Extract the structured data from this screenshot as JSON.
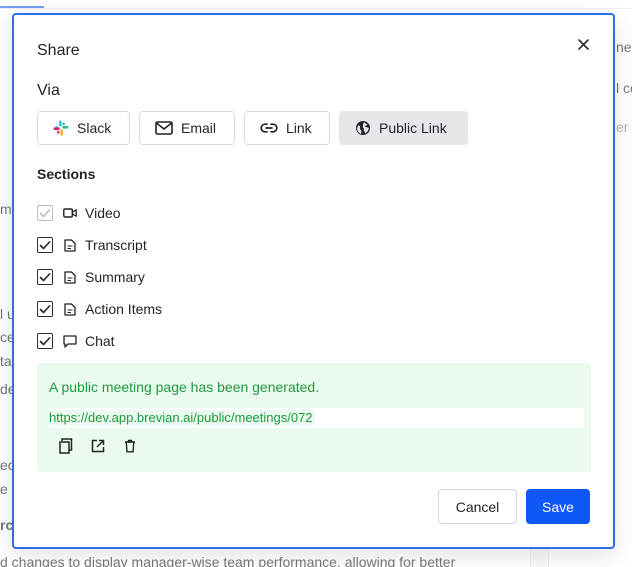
{
  "background": {
    "right_texts": [
      "ne",
      "l co",
      "er"
    ],
    "left_fragments": [
      "m",
      "l u",
      "ce",
      "ta",
      "de",
      "ec",
      "e r",
      "rc"
    ],
    "bottom_line": "d changes to display manager-wise team performance, allowing for better"
  },
  "modal": {
    "title": "Share",
    "close_icon": "close-icon",
    "via_label": "Via",
    "via_options": [
      {
        "label": "Slack",
        "icon": "slack-icon",
        "active": false
      },
      {
        "label": "Email",
        "icon": "mail-icon",
        "active": false
      },
      {
        "label": "Link",
        "icon": "link-icon",
        "active": false
      },
      {
        "label": "Public Link",
        "icon": "globe-icon",
        "active": true
      }
    ],
    "sections_label": "Sections",
    "sections": [
      {
        "label": "Video",
        "icon": "video-icon",
        "checked": true,
        "disabled": true
      },
      {
        "label": "Transcript",
        "icon": "document-icon",
        "checked": true,
        "disabled": false
      },
      {
        "label": "Summary",
        "icon": "document-icon",
        "checked": true,
        "disabled": false
      },
      {
        "label": "Action Items",
        "icon": "document-icon",
        "checked": true,
        "disabled": false
      },
      {
        "label": "Chat",
        "icon": "chat-icon",
        "checked": true,
        "disabled": false
      }
    ],
    "public_link": {
      "message": "A public meeting page has been generated.",
      "url": "https://dev.app.brevian.ai/public/meetings/072",
      "actions": [
        "copy-icon",
        "open-external-icon",
        "trash-icon"
      ]
    },
    "cancel_label": "Cancel",
    "save_label": "Save"
  },
  "colors": {
    "accent": "#1058f5",
    "modal_border": "#2f6fe4",
    "success_text": "#1e9a3f",
    "success_bg": "#ebfaef",
    "active_option_bg": "#e5e7ea"
  }
}
